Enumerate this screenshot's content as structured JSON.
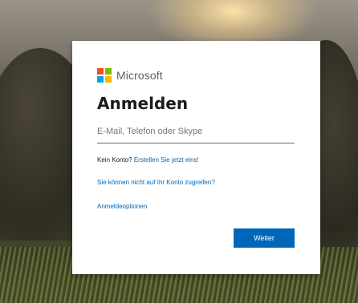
{
  "brand": {
    "name": "Microsoft",
    "logo_colors": [
      "#f25022",
      "#7fba00",
      "#00a4ef",
      "#ffb900"
    ]
  },
  "signin": {
    "title": "Anmelden",
    "input_placeholder": "E-Mail, Telefon oder Skype",
    "input_value": "",
    "no_account_text": "Kein Konto?",
    "create_link": "Erstellen Sie jetzt eins!",
    "cant_access_link": "Sie können nicht auf Ihr Konto zugreifen?",
    "options_link": "Anmeldeoptionen",
    "next_button": "Weiter"
  },
  "colors": {
    "accent": "#0067b8",
    "text": "#1b1b1b",
    "card_background": "#ffffff"
  }
}
